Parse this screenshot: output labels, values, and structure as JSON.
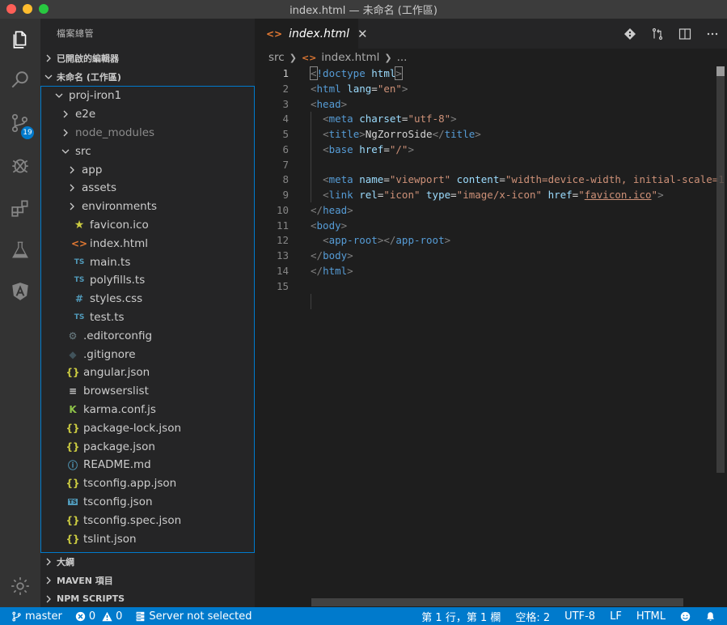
{
  "window": {
    "title": "index.html — 未命名 (工作區)"
  },
  "activity_bar": {
    "icons": [
      "files-icon",
      "search-icon",
      "source-control-icon",
      "debug-icon",
      "extensions-icon",
      "test-flask-icon",
      "angular-icon",
      "gear-icon"
    ],
    "scm_badge": "19"
  },
  "sidebar": {
    "header": "檔案總管",
    "open_editors": "已開啟的編輯器",
    "workspace": "未命名 (工作區)",
    "tree": [
      {
        "label": "proj-iron1",
        "kind": "folder-open",
        "depth": 0
      },
      {
        "label": "e2e",
        "kind": "folder",
        "depth": 1
      },
      {
        "label": "node_modules",
        "kind": "folder",
        "depth": 1,
        "dim": true
      },
      {
        "label": "src",
        "kind": "folder-open",
        "depth": 1
      },
      {
        "label": "app",
        "kind": "folder",
        "depth": 2
      },
      {
        "label": "assets",
        "kind": "folder",
        "depth": 2
      },
      {
        "label": "environments",
        "kind": "folder",
        "depth": 2
      },
      {
        "label": "favicon.ico",
        "kind": "star",
        "depth": 2
      },
      {
        "label": "index.html",
        "kind": "html",
        "depth": 2
      },
      {
        "label": "main.ts",
        "kind": "ts",
        "depth": 2
      },
      {
        "label": "polyfills.ts",
        "kind": "ts",
        "depth": 2
      },
      {
        "label": "styles.css",
        "kind": "css",
        "depth": 2
      },
      {
        "label": "test.ts",
        "kind": "ts",
        "depth": 2
      },
      {
        "label": ".editorconfig",
        "kind": "gear",
        "depth": 1
      },
      {
        "label": ".gitignore",
        "kind": "git",
        "depth": 1
      },
      {
        "label": "angular.json",
        "kind": "json",
        "depth": 1
      },
      {
        "label": "browserslist",
        "kind": "lines",
        "depth": 1
      },
      {
        "label": "karma.conf.js",
        "kind": "karma",
        "depth": 1
      },
      {
        "label": "package-lock.json",
        "kind": "json",
        "depth": 1
      },
      {
        "label": "package.json",
        "kind": "json",
        "depth": 1
      },
      {
        "label": "README.md",
        "kind": "info",
        "depth": 1
      },
      {
        "label": "tsconfig.app.json",
        "kind": "json",
        "depth": 1
      },
      {
        "label": "tsconfig.json",
        "kind": "tsconfig",
        "depth": 1
      },
      {
        "label": "tsconfig.spec.json",
        "kind": "json",
        "depth": 1
      },
      {
        "label": "tslint.json",
        "kind": "json",
        "depth": 1
      }
    ],
    "outline": "大綱",
    "maven": "MAVEN 項目",
    "npm": "NPM SCRIPTS"
  },
  "editor": {
    "tab_label": "index.html",
    "breadcrumb": [
      "src",
      "index.html",
      "..."
    ],
    "line_numbers": [
      "1",
      "2",
      "3",
      "4",
      "5",
      "6",
      "7",
      "8",
      "9",
      "10",
      "11",
      "12",
      "13",
      "14",
      "15"
    ]
  },
  "status": {
    "branch": "master",
    "errors": "0",
    "warnings": "0",
    "server": "Server not selected",
    "position": "第 1 行，第 1 欄",
    "spaces": "空格: 2",
    "encoding": "UTF-8",
    "eol": "LF",
    "language": "HTML"
  },
  "colors": {
    "accent": "#007acc",
    "activity_bg": "#333333",
    "sidebar_bg": "#252526",
    "editor_bg": "#1e1e1e"
  }
}
